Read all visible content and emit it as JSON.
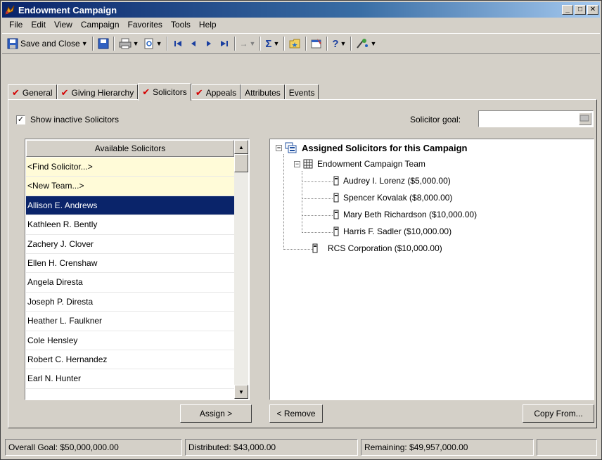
{
  "window": {
    "title": "Endowment Campaign"
  },
  "menu": {
    "items": [
      {
        "label": "File"
      },
      {
        "label": "Edit"
      },
      {
        "label": "View"
      },
      {
        "label": "Campaign"
      },
      {
        "label": "Favorites"
      },
      {
        "label": "Tools"
      },
      {
        "label": "Help"
      }
    ]
  },
  "toolbar": {
    "save_close_label": "Save and Close"
  },
  "tabs": [
    {
      "label": "General",
      "checked": true
    },
    {
      "label": "Giving Hierarchy",
      "checked": true
    },
    {
      "label": "Solicitors",
      "checked": true,
      "active": true
    },
    {
      "label": "Appeals",
      "checked": true
    },
    {
      "label": "Attributes",
      "checked": false
    },
    {
      "label": "Events",
      "checked": false
    }
  ],
  "options": {
    "show_inactive_label": "Show inactive Solicitors",
    "show_inactive_checked": true,
    "solicitor_goal_label": "Solicitor goal:",
    "solicitor_goal_value": ""
  },
  "available": {
    "header": "Available Solicitors",
    "rows": [
      {
        "label": "<Find Solicitor...>",
        "kind": "special"
      },
      {
        "label": "<New Team...>",
        "kind": "special"
      },
      {
        "label": "Allison E. Andrews",
        "kind": "selected"
      },
      {
        "label": "Kathleen R. Bently",
        "kind": "normal"
      },
      {
        "label": "Zachery J. Clover",
        "kind": "normal"
      },
      {
        "label": "Ellen H. Crenshaw",
        "kind": "normal"
      },
      {
        "label": "Angela Diresta",
        "kind": "normal"
      },
      {
        "label": "Joseph P. Diresta",
        "kind": "normal"
      },
      {
        "label": "Heather L. Faulkner",
        "kind": "normal"
      },
      {
        "label": "Cole Hensley",
        "kind": "normal"
      },
      {
        "label": "Robert C. Hernandez",
        "kind": "normal"
      },
      {
        "label": "Earl N. Hunter",
        "kind": "normal"
      }
    ]
  },
  "tree": {
    "root": "Assigned Solicitors for this Campaign",
    "team": "Endowment Campaign Team",
    "members": [
      "Audrey I. Lorenz ($5,000.00)",
      "Spencer Kovalak ($8,000.00)",
      "Mary Beth Richardson ($10,000.00)",
      "Harris F. Sadler ($10,000.00)"
    ],
    "other": "RCS Corporation ($10,000.00)"
  },
  "buttons": {
    "assign": "Assign >",
    "remove": "< Remove",
    "copy_from": "Copy From..."
  },
  "status": {
    "overall_goal": "Overall Goal: $50,000,000.00",
    "distributed": "Distributed: $43,000.00",
    "remaining": "Remaining: $49,957,000.00"
  }
}
